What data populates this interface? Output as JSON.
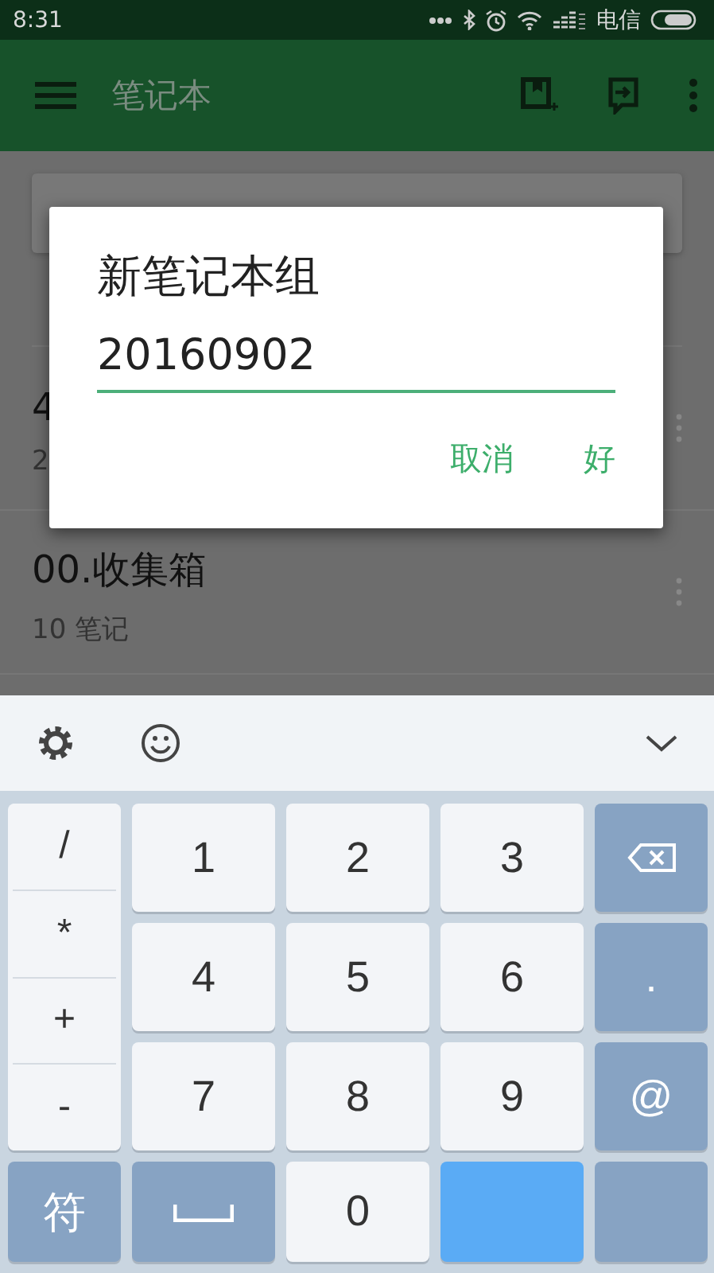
{
  "status_bar": {
    "time": "8:31",
    "carrier": "电信"
  },
  "app_bar": {
    "title": "笔记本"
  },
  "notebooks": [
    {
      "title": "4",
      "count": "2"
    },
    {
      "title": "00.收集箱",
      "count": "10 笔记"
    }
  ],
  "dialog": {
    "title": "新笔记本组",
    "value": "20160902",
    "buttons": [
      "取消",
      "好"
    ]
  },
  "keyboard": {
    "symbol_keys": [
      "/",
      "*",
      "+",
      "-"
    ],
    "digit_keys": [
      "1",
      "2",
      "3",
      "4",
      "5",
      "6",
      "7",
      "8",
      "9"
    ],
    "right_keys": [
      {
        "kind": "backspace"
      },
      {
        "kind": "symbol",
        "label": "."
      },
      {
        "kind": "symbol",
        "label": "@"
      }
    ],
    "bottom_keys": [
      {
        "kind": "symbol",
        "label": "符"
      },
      {
        "kind": "space"
      },
      {
        "kind": "digit",
        "label": "0"
      },
      {
        "kind": "enter"
      },
      {
        "kind": "blank"
      }
    ]
  }
}
